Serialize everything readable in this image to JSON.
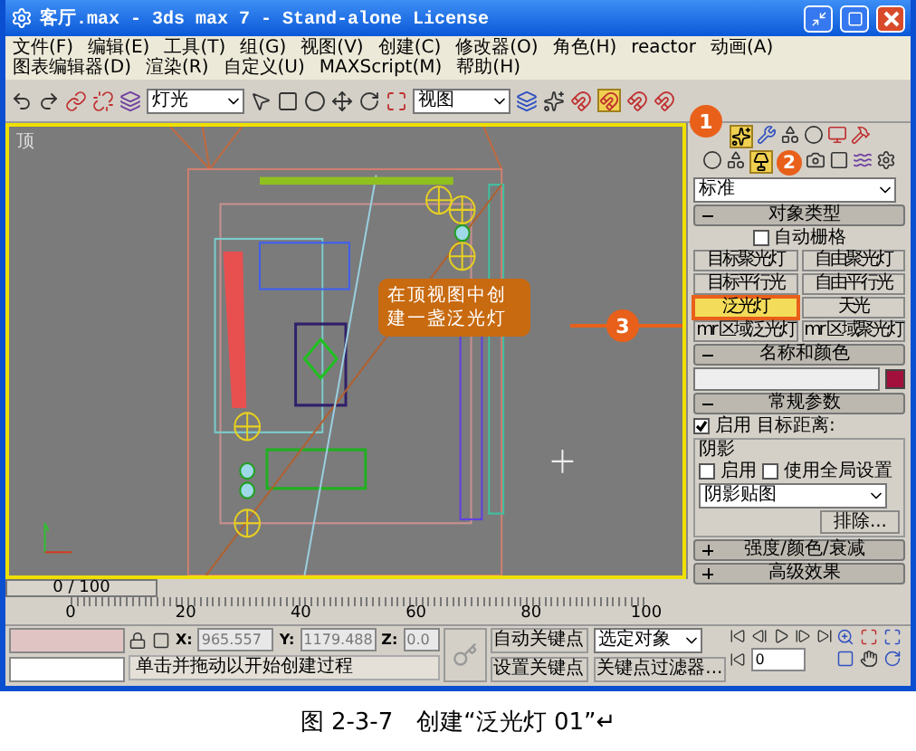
{
  "window": {
    "title": "客厅.max - 3ds max 7  - Stand-alone License"
  },
  "menu": [
    "文件(F)",
    "编辑(E)",
    "工具(T)",
    "组(G)",
    "视图(V)",
    "创建(C)",
    "修改器(O)",
    "角色(H)",
    "reactor",
    "动画(A)",
    "图表编辑器(D)",
    "渲染(R)",
    "自定义(U)",
    "MAXScript(M)",
    "帮助(H)"
  ],
  "toolbar": {
    "selects": [
      "灯光",
      "视图"
    ]
  },
  "viewport": {
    "label": "顶",
    "callout": "在顶视图中创建一盏泛光灯"
  },
  "badges": [
    "1",
    "2",
    "3"
  ],
  "command_panel": {
    "category": "标准",
    "object_type": {
      "title": "对象类型",
      "expanded": true,
      "autogrid": {
        "label": "自动栅格",
        "checked": false
      },
      "buttons": [
        {
          "label": "目标聚光灯",
          "selected": false
        },
        {
          "label": "自由聚光灯",
          "selected": false
        },
        {
          "label": "目标平行光",
          "selected": false
        },
        {
          "label": "自由平行光",
          "selected": false
        },
        {
          "label": "泛光灯",
          "selected": true
        },
        {
          "label": "天光",
          "selected": false
        },
        {
          "label": "mr 区域泛光灯",
          "selected": false
        },
        {
          "label": "mr 区域聚光灯",
          "selected": false
        }
      ]
    },
    "name_color": {
      "title": "名称和颜色",
      "expanded": true,
      "color": "#a3103c"
    },
    "general": {
      "title": "常规参数",
      "expanded": true,
      "on": {
        "label": "启用",
        "checked": true
      },
      "target_label": "目标距离:",
      "shadow": {
        "title": "阴影",
        "on": {
          "label": "启用",
          "checked": false
        },
        "global": {
          "label": "使用全局设置",
          "checked": false
        },
        "type": "阴影贴图",
        "exclude": "排除..."
      }
    },
    "collapsed": [
      {
        "title": "强度/颜色/衰减",
        "expanded": false
      },
      {
        "title": "高级效果",
        "expanded": false
      }
    ]
  },
  "timeline": {
    "frame": "0 / 100",
    "level": 0,
    "ruler": [
      "0",
      "20",
      "40",
      "60",
      "80",
      "100"
    ]
  },
  "status": {
    "coords": [
      {
        "axis": "X:",
        "value": "965.557"
      },
      {
        "axis": "Y:",
        "value": "1179.488"
      },
      {
        "axis": "Z:",
        "value": "0.0"
      }
    ],
    "auto_key": "自动关键点",
    "key_mode": "选定对象",
    "set_key": "设置关键点",
    "key_filters": "关键点过滤器...",
    "current_frame": "0",
    "prompt": "单击并拖动以开始创建过程"
  },
  "caption": "图 2-3-7　创建“泛光灯 01”↵"
}
